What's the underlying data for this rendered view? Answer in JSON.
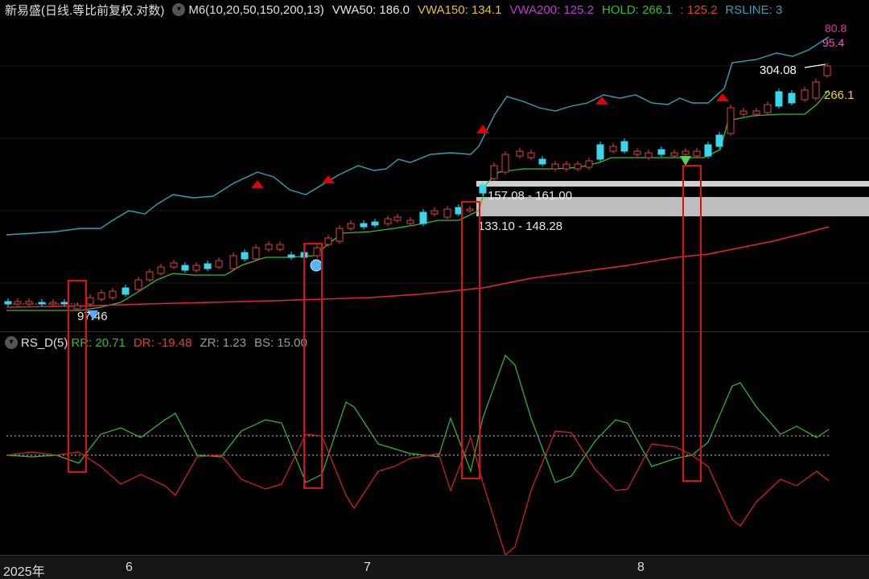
{
  "header": {
    "title": "新易盛(日线.等比前复权.对数)",
    "ma": "M6(10,20,50,150,200,13)",
    "vwa50": "VWA50: 186.0",
    "vwa150": "VWA150: 134.1",
    "vwa200": "VWA200: 125.2",
    "hold": "HOLD: 266.1",
    "extra": ": 125.2",
    "rsline": "RSLINE: 3",
    "colors": {
      "vwa50": "#e8e8e8",
      "vwa150": "#e6c229",
      "vwa200": "#c13bd6",
      "hold": "#2fbf2f",
      "extra": "#e23b3b",
      "rsline": "#2aa4b8"
    }
  },
  "price_labels": {
    "top1": "80.8",
    "top2": "95.4",
    "high": "304.08",
    "hold_val": "266.1",
    "low": "97.46",
    "zone1": "157.08 - 161.00",
    "zone2": "133.10 - 148.28"
  },
  "sub_header": {
    "name": "RS_D(5)",
    "rr": "RR: 20.71",
    "dr": "DR: -19.48",
    "zr": "ZR: 1.23",
    "bs": "BS: 15.00"
  },
  "x_axis": {
    "labels": [
      "2025年",
      "6",
      "7",
      "8"
    ]
  }
}
